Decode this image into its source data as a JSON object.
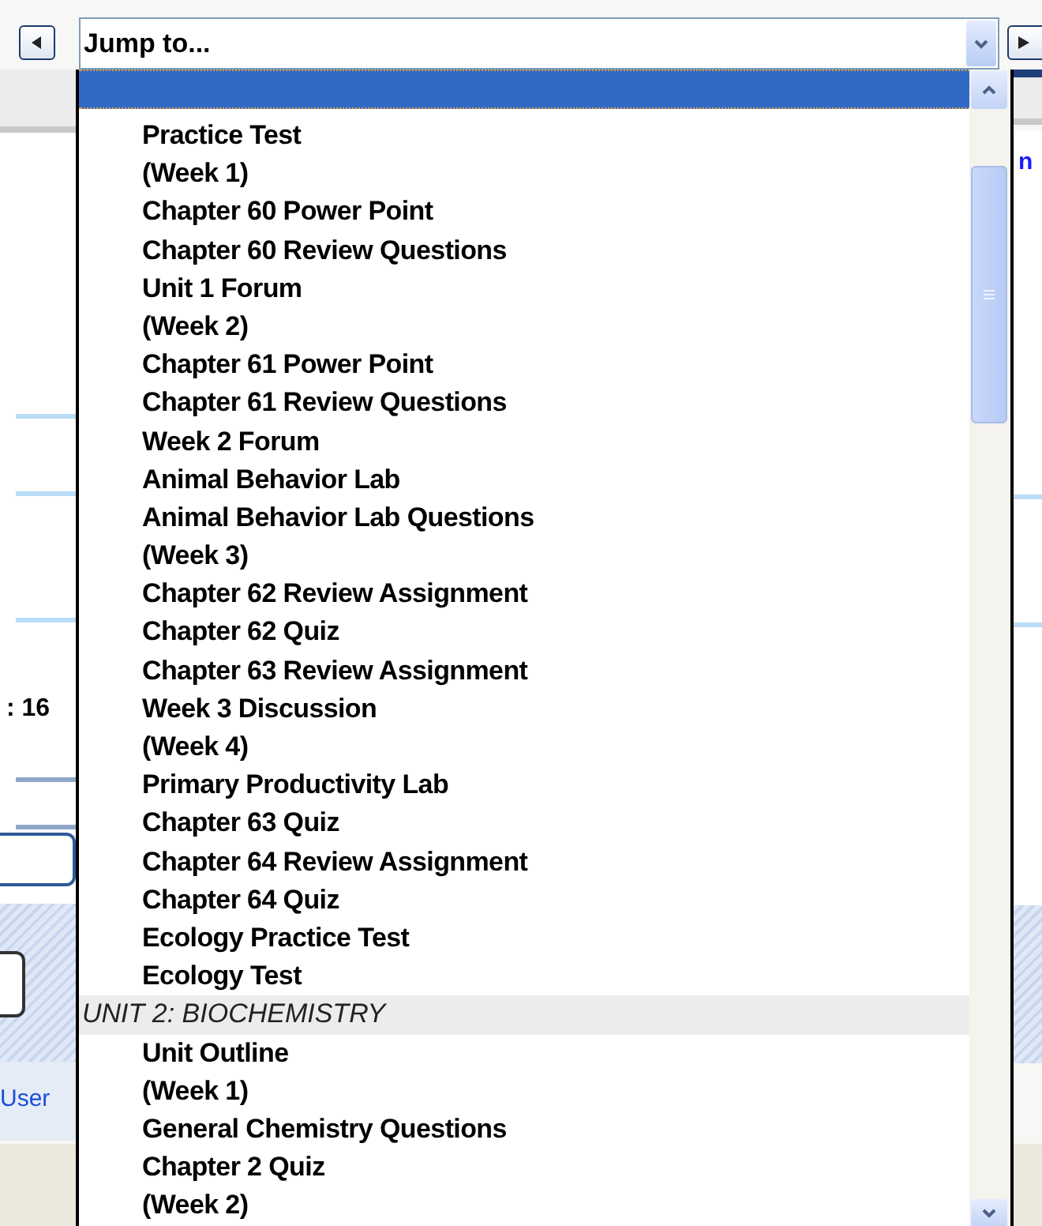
{
  "jump_select": {
    "value": "Jump to..."
  },
  "list": {
    "items": [
      {
        "kind": "blank",
        "selected": true
      },
      {
        "kind": "item",
        "label": "Practice Test",
        "selected": false
      },
      {
        "kind": "item",
        "label": "(Week 1)",
        "selected": false
      },
      {
        "kind": "item",
        "label": "Chapter 60 Power Point",
        "selected": false
      },
      {
        "kind": "item",
        "label": "Chapter 60 Review Questions",
        "selected": false
      },
      {
        "kind": "item",
        "label": "Unit 1 Forum",
        "selected": false
      },
      {
        "kind": "item",
        "label": "(Week 2)",
        "selected": false
      },
      {
        "kind": "item",
        "label": "Chapter 61 Power Point",
        "selected": false
      },
      {
        "kind": "item",
        "label": "Chapter 61 Review Questions",
        "selected": false
      },
      {
        "kind": "item",
        "label": "Week 2 Forum",
        "selected": false
      },
      {
        "kind": "item",
        "label": "Animal Behavior Lab",
        "selected": false
      },
      {
        "kind": "item",
        "label": "Animal Behavior Lab Questions",
        "selected": false
      },
      {
        "kind": "item",
        "label": "(Week 3)",
        "selected": false
      },
      {
        "kind": "item",
        "label": "Chapter 62 Review Assignment",
        "selected": false
      },
      {
        "kind": "item",
        "label": "Chapter 62 Quiz",
        "selected": false
      },
      {
        "kind": "item",
        "label": "Chapter 63 Review Assignment",
        "selected": false
      },
      {
        "kind": "item",
        "label": "Week 3 Discussion",
        "selected": false
      },
      {
        "kind": "item",
        "label": "(Week 4)",
        "selected": false
      },
      {
        "kind": "item",
        "label": "Primary Productivity Lab",
        "selected": false
      },
      {
        "kind": "item",
        "label": "Chapter 63 Quiz",
        "selected": false
      },
      {
        "kind": "item",
        "label": "Chapter 64 Review Assignment",
        "selected": false
      },
      {
        "kind": "item",
        "label": "Chapter 64 Quiz",
        "selected": false
      },
      {
        "kind": "item",
        "label": "Ecology Practice Test",
        "selected": false
      },
      {
        "kind": "item",
        "label": "Ecology Test",
        "selected": false
      },
      {
        "kind": "group",
        "label": "UNIT 2: BIOCHEMISTRY"
      },
      {
        "kind": "item",
        "label": "Unit Outline",
        "selected": false
      },
      {
        "kind": "item",
        "label": "(Week 1)",
        "selected": false
      },
      {
        "kind": "item",
        "label": "General Chemistry Questions",
        "selected": false
      },
      {
        "kind": "item",
        "label": "Chapter 2 Quiz",
        "selected": false
      },
      {
        "kind": "item",
        "label": "(Week 2)",
        "selected": false
      }
    ]
  },
  "background": {
    "time_fragment": ": 16",
    "user_link": "User",
    "heading_fragment": "n"
  }
}
